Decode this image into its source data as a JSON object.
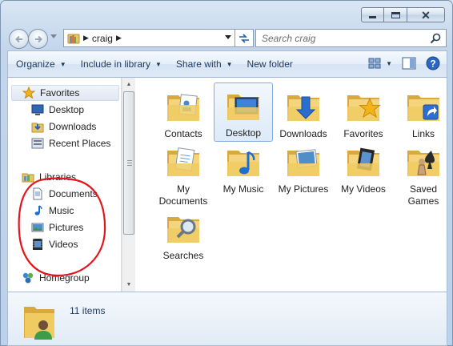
{
  "address": {
    "crumb": "craig",
    "sep": "▶"
  },
  "search": {
    "placeholder": "Search craig"
  },
  "toolbar": {
    "organize": "Organize",
    "include": "Include in library",
    "share": "Share with",
    "newfolder": "New folder"
  },
  "nav": {
    "favorites": "Favorites",
    "desktop": "Desktop",
    "downloads": "Downloads",
    "recent": "Recent Places",
    "libraries": "Libraries",
    "documents": "Documents",
    "music": "Music",
    "pictures": "Pictures",
    "videos": "Videos",
    "homegroup": "Homegroup"
  },
  "files": [
    {
      "label": "Contacts",
      "icon": "contacts-folder-icon"
    },
    {
      "label": "Desktop",
      "icon": "desktop-folder-icon"
    },
    {
      "label": "Downloads",
      "icon": "downloads-folder-icon"
    },
    {
      "label": "Favorites",
      "icon": "favorites-folder-icon"
    },
    {
      "label": "Links",
      "icon": "links-folder-icon"
    },
    {
      "label": "My Documents",
      "icon": "documents-folder-icon"
    },
    {
      "label": "My Music",
      "icon": "music-folder-icon"
    },
    {
      "label": "My Pictures",
      "icon": "pictures-folder-icon"
    },
    {
      "label": "My Videos",
      "icon": "videos-folder-icon"
    },
    {
      "label": "Saved Games",
      "icon": "games-folder-icon"
    },
    {
      "label": "Searches",
      "icon": "searches-folder-icon"
    }
  ],
  "status": {
    "count": "11 items"
  },
  "colors": {
    "annotation": "#e3141a",
    "selection": "#dceaf9",
    "toolbar_text": "#1e395b"
  }
}
